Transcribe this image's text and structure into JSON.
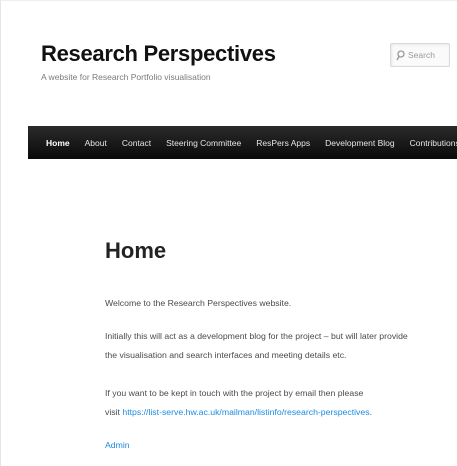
{
  "header": {
    "site_title": "Research Perspectives",
    "tagline": "A website for Research Portfolio visualisation"
  },
  "search": {
    "placeholder": "Search",
    "icon": "search-icon"
  },
  "nav": {
    "items": [
      {
        "label": "Home",
        "active": true
      },
      {
        "label": "About"
      },
      {
        "label": "Contact"
      },
      {
        "label": "Steering Committee"
      },
      {
        "label": "ResPers Apps"
      },
      {
        "label": "Development Blog"
      },
      {
        "label": "Contributions"
      }
    ]
  },
  "main": {
    "title": "Home",
    "paragraph1": "Welcome to the Research Perspectives website.",
    "paragraph2_line1": "Initially this will act as a development blog for the project – but will later provide",
    "paragraph2_line2": "the visualisation and search interfaces and meeting details etc.",
    "paragraph3_line1": "If you want to be kept in touch with the project by email then please",
    "paragraph3_prefix": "visit ",
    "paragraph3_link": "https://list-serve.hw.ac.uk/mailman/listinfo/research-perspectives",
    "paragraph3_suffix": ".",
    "admin_link": "Admin"
  },
  "colors": {
    "nav_background": "#111111",
    "link": "#1b8be0",
    "title": "#111111"
  }
}
